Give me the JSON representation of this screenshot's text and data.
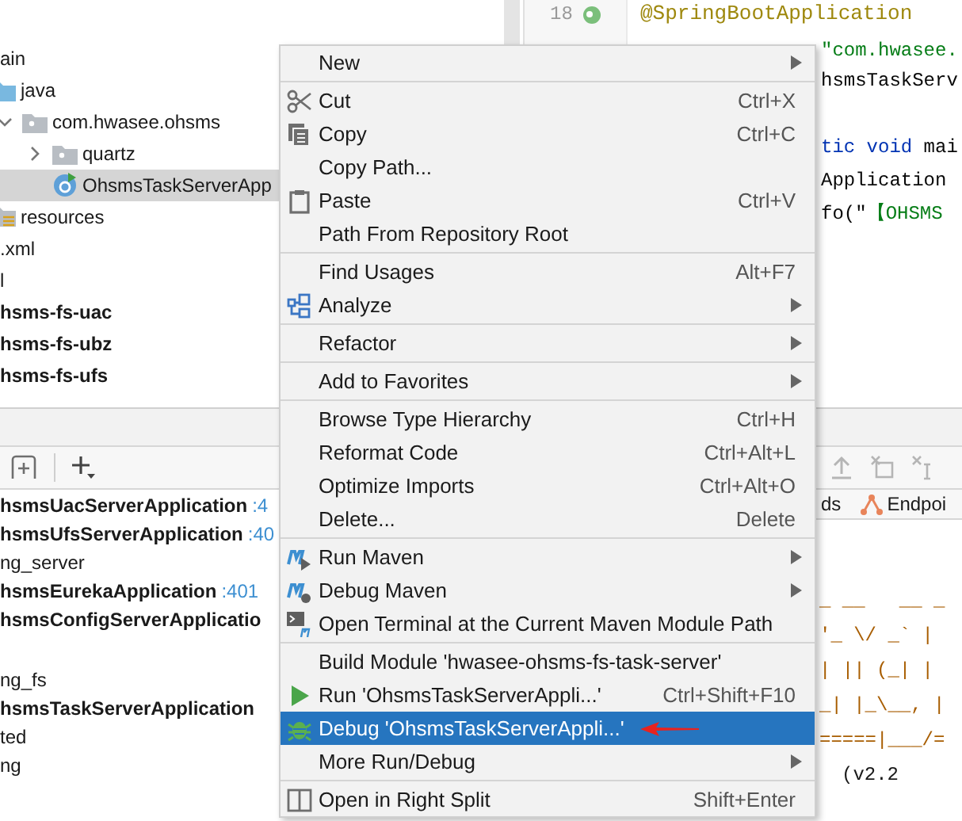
{
  "project_tree": {
    "rows": [
      {
        "label": "ain",
        "bold": false,
        "selected": false,
        "children": [
          {
            "label": "java",
            "bold": false,
            "selected": false,
            "kind": "source-folder",
            "children": [
              {
                "label": "com.hwasee.ohsms",
                "bold": false,
                "selected": false,
                "kind": "package",
                "expanded": true,
                "children": [
                  {
                    "label": "quartz",
                    "bold": false,
                    "selected": false,
                    "kind": "package",
                    "expanded": false
                  },
                  {
                    "label": "OhsmsTaskServerApp",
                    "bold": false,
                    "selected": true,
                    "kind": "class"
                  }
                ]
              }
            ]
          },
          {
            "label": "resources",
            "bold": false,
            "selected": false,
            "kind": "resources"
          }
        ]
      },
      {
        "label": ".xml",
        "bold": false,
        "selected": false
      },
      {
        "label": "l",
        "bold": false,
        "selected": false
      },
      {
        "label": "hsms-fs-uac",
        "bold": true,
        "selected": false
      },
      {
        "label": "hsms-fs-ubz",
        "bold": true,
        "selected": false
      },
      {
        "label": "hsms-fs-ufs",
        "bold": true,
        "selected": false
      }
    ]
  },
  "editor": {
    "gutter_line": "18",
    "lines": [
      [
        {
          "text": "@SpringBootApplication",
          "kind": "annotation"
        }
      ],
      [
        {
          "text": "\"com.hwasee.",
          "kind": "string"
        }
      ],
      [
        {
          "text": "hsmsTaskServ",
          "kind": "plain"
        }
      ],
      [
        {
          "text": "tic void",
          "kind": "keyword"
        },
        {
          "text": " mai",
          "kind": "plain"
        }
      ],
      [
        {
          "text": "Application",
          "kind": "plain"
        }
      ],
      [
        {
          "text": "fo(\"",
          "kind": "plain"
        },
        {
          "text": "【OHSMS",
          "kind": "string"
        }
      ]
    ]
  },
  "services": {
    "rows": [
      {
        "label": "hsmsUacServerApplication",
        "bold": true,
        "port": ":4"
      },
      {
        "label": "hsmsUfsServerApplication",
        "bold": true,
        "port": ":40"
      },
      {
        "label": "ng_server",
        "bold": false
      },
      {
        "label": "hsmsEurekaApplication",
        "bold": true,
        "port": ":401"
      },
      {
        "label": "hsmsConfigServerApplicatio",
        "bold": true
      },
      {
        "label": "ng_fs",
        "bold": false
      },
      {
        "label": "hsmsTaskServerApplication",
        "bold": true
      },
      {
        "label": "ted",
        "bold": false
      },
      {
        "label": "ng",
        "bold": false
      }
    ]
  },
  "console": {
    "tabs": [
      {
        "label": "ds",
        "kind": "plain"
      },
      {
        "label": "Endpoi",
        "kind": "endpoints"
      }
    ],
    "lines": [
      "_ __   __ _",
      "'_ \\/ _` |",
      "| || (_| |",
      "_| |_\\__, |",
      "=====|___/=",
      "(v2.2"
    ]
  },
  "context_menu": {
    "items": [
      {
        "kind": "item",
        "label": "New",
        "submenu": true,
        "selected": false
      },
      {
        "kind": "separator"
      },
      {
        "kind": "item",
        "label": "Cut",
        "shortcut": "Ctrl+X",
        "submenu": false,
        "selected": false
      },
      {
        "kind": "item",
        "label": "Copy",
        "shortcut": "Ctrl+C",
        "submenu": false,
        "selected": false
      },
      {
        "kind": "item",
        "label": "Copy Path...",
        "submenu": false,
        "selected": false
      },
      {
        "kind": "item",
        "label": "Paste",
        "shortcut": "Ctrl+V",
        "submenu": false,
        "selected": false
      },
      {
        "kind": "item",
        "label": "Path From Repository Root",
        "submenu": false,
        "selected": false
      },
      {
        "kind": "separator"
      },
      {
        "kind": "item",
        "label": "Find Usages",
        "shortcut": "Alt+F7",
        "submenu": false,
        "selected": false
      },
      {
        "kind": "item",
        "label": "Analyze",
        "submenu": true,
        "selected": false
      },
      {
        "kind": "separator"
      },
      {
        "kind": "item",
        "label": "Refactor",
        "submenu": true,
        "selected": false
      },
      {
        "kind": "separator"
      },
      {
        "kind": "item",
        "label": "Add to Favorites",
        "submenu": true,
        "selected": false
      },
      {
        "kind": "separator"
      },
      {
        "kind": "item",
        "label": "Browse Type Hierarchy",
        "shortcut": "Ctrl+H",
        "submenu": false,
        "selected": false
      },
      {
        "kind": "item",
        "label": "Reformat Code",
        "shortcut": "Ctrl+Alt+L",
        "submenu": false,
        "selected": false
      },
      {
        "kind": "item",
        "label": "Optimize Imports",
        "shortcut": "Ctrl+Alt+O",
        "submenu": false,
        "selected": false
      },
      {
        "kind": "item",
        "label": "Delete...",
        "shortcut": "Delete",
        "submenu": false,
        "selected": false
      },
      {
        "kind": "separator"
      },
      {
        "kind": "item",
        "label": "Run Maven",
        "submenu": true,
        "selected": false
      },
      {
        "kind": "item",
        "label": "Debug Maven",
        "submenu": true,
        "selected": false
      },
      {
        "kind": "item",
        "label": "Open Terminal at the Current Maven Module Path",
        "submenu": false,
        "selected": false
      },
      {
        "kind": "separator"
      },
      {
        "kind": "item",
        "label": "Build Module 'hwasee-ohsms-fs-task-server'",
        "submenu": false,
        "selected": false
      },
      {
        "kind": "item",
        "label": "Run 'OhsmsTaskServerAppli...'",
        "shortcut": "Ctrl+Shift+F10",
        "submenu": false,
        "selected": false
      },
      {
        "kind": "item",
        "label": "Debug 'OhsmsTaskServerAppli...'",
        "submenu": false,
        "selected": true
      },
      {
        "kind": "item",
        "label": "More Run/Debug",
        "submenu": true,
        "selected": false
      },
      {
        "kind": "separator"
      },
      {
        "kind": "item",
        "label": "Open in Right Split",
        "shortcut": "Shift+Enter",
        "submenu": false,
        "selected": false
      }
    ]
  }
}
